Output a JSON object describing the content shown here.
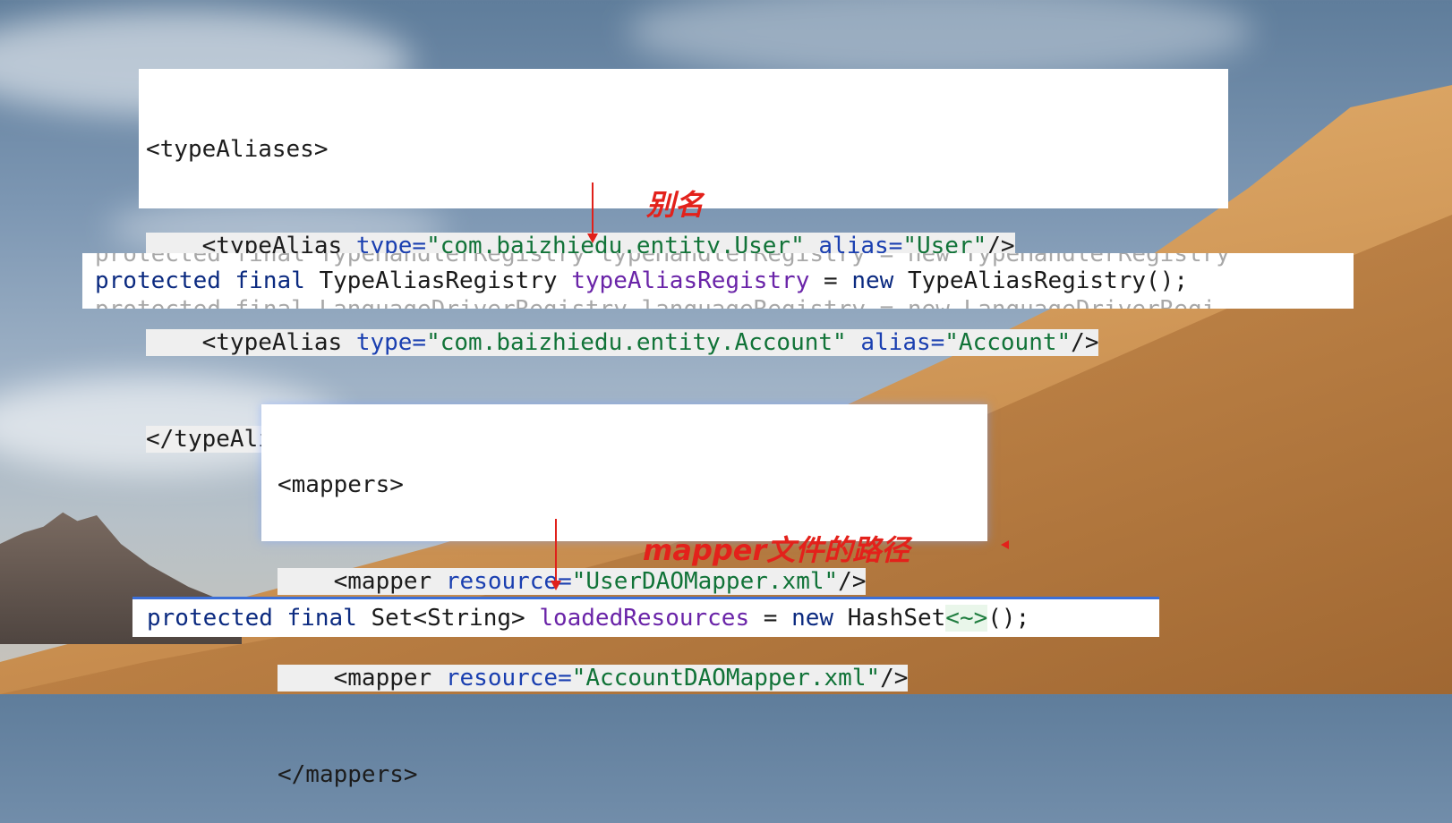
{
  "type_aliases_xml": {
    "open_tag": "<typeAliases>",
    "aliases": [
      {
        "prefix": "<typeAlias ",
        "type_attr": "type=",
        "type_value": "\"com.baizhiedu.entity.User\"",
        "alias_attr": "alias=",
        "alias_value": "\"User\"",
        "close": "/>"
      },
      {
        "prefix": "<typeAlias ",
        "type_attr": "type=",
        "type_value": "\"com.baizhiedu.entity.Account\"",
        "alias_attr": "alias=",
        "alias_value": "\"Account\"",
        "close": "/>"
      }
    ],
    "close_tag": "</typeAliases>"
  },
  "alias_note": "别名",
  "java_alias": {
    "ghost_above": "protected final TypeHandlerRegistry typeHandlerRegistry = new TypeHandlerRegistry",
    "kw1": "protected final",
    "type": "TypeAliasRegistry",
    "field": "typeAliasRegistry",
    "assign": "=",
    "kw2": "new",
    "ctor": "TypeAliasRegistry();",
    "ghost_below": "protected final LanguageDriverRegistry languageRegistry = new LanguageDriverRegi"
  },
  "mappers_xml": {
    "open_tag": "<mappers>",
    "mappers": [
      {
        "prefix": "<mapper ",
        "attr": "resource=",
        "value": "\"UserDAOMapper.xml\"",
        "close": "/>"
      },
      {
        "prefix": "<mapper ",
        "attr": "resource=",
        "value": "\"AccountDAOMapper.xml\"",
        "close": "/>"
      }
    ],
    "close_tag": "</mappers>"
  },
  "mapper_note": "mapper文件的路径",
  "java_mapper": {
    "kw1": "protected final",
    "type": "Set<String>",
    "field": "loadedResources",
    "assign": "=",
    "kw2": "new",
    "ctor": "HashSet",
    "generic": "<~>",
    "tail": "();"
  },
  "colors": {
    "annotation": "#e3211b",
    "attribute": "#1a3fb0",
    "string": "#117338",
    "keyword": "#0b2a80",
    "field": "#6a24a8"
  }
}
